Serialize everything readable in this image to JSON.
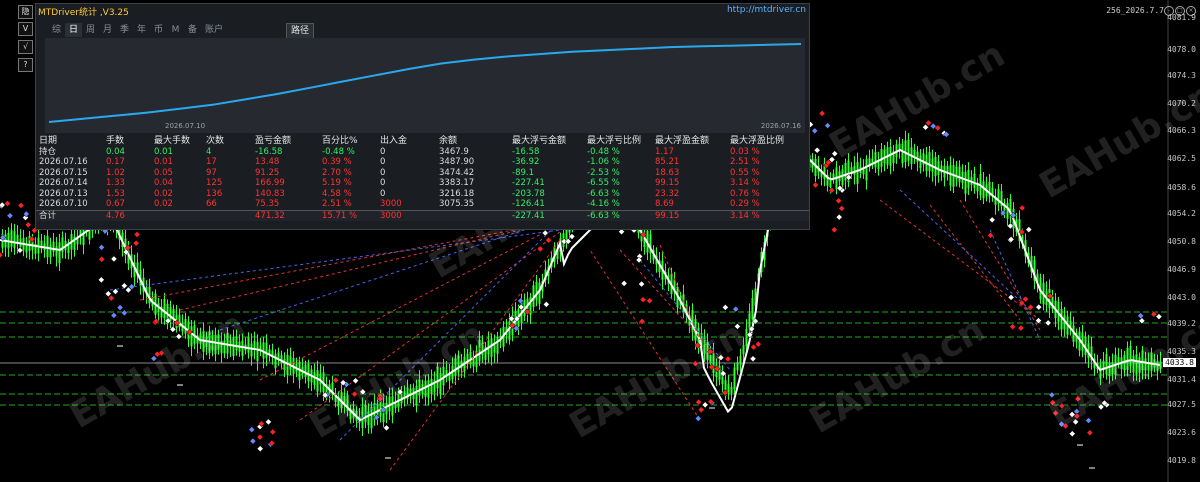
{
  "server_label": "256_2026.7.7",
  "window_controls": [
    "-",
    "□",
    "×"
  ],
  "watermark": "EAHub.cn",
  "price_axis": [
    "4081.9",
    "4078.0",
    "4074.3",
    "4070.2",
    "4066.3",
    "4062.5",
    "4058.6",
    "4054.2",
    "4050.8",
    "4046.9",
    "4043.0",
    "4039.2",
    "4035.3",
    "4033.8",
    "4031.4",
    "4027.5",
    "4023.6",
    "4019.8"
  ],
  "sidebar_buttons": [
    "隐",
    "V",
    "√",
    "?"
  ],
  "panel": {
    "title": "MTDriver统计 ,V3.25",
    "url": "http://mtdriver.cn",
    "tabs": [
      "综",
      "日",
      "周",
      "月",
      "季",
      "年",
      "币",
      "M",
      "备",
      "账户"
    ],
    "active_tab": "日",
    "path_tab": "路径",
    "chart_start_date": "2026.07.10",
    "chart_end_date": "2026.07.16",
    "columns": [
      "日期",
      "手数",
      "最大手数",
      "次数",
      "盈亏金额",
      "百分比%",
      "出入金",
      "余额",
      "最大浮亏金额",
      "最大浮亏比例",
      "最大浮盈金额",
      "最大浮盈比例"
    ],
    "rows": [
      [
        "持仓",
        "0.04",
        "0.01",
        "4",
        "-16.58",
        "-0.48 %",
        "0",
        "3467.9",
        "-16.58",
        "-0.48 %",
        "1.17",
        "0.03 %"
      ],
      [
        "2026.07.16",
        "0.17",
        "0.01",
        "17",
        "13.48",
        "0.39 %",
        "0",
        "3487.90",
        "-36.92",
        "-1.06 %",
        "85.21",
        "2.51 %"
      ],
      [
        "2026.07.15",
        "1.02",
        "0.05",
        "97",
        "91.25",
        "2.70 %",
        "0",
        "3474.42",
        "-89.1",
        "-2.53 %",
        "18.63",
        "0.55 %"
      ],
      [
        "2026.07.14",
        "1.33",
        "0.04",
        "125",
        "166.99",
        "5.19 %",
        "0",
        "3383.17",
        "-227.41",
        "-6.55 %",
        "99.15",
        "3.14 %"
      ],
      [
        "2026.07.13",
        "1.53",
        "0.02",
        "136",
        "140.83",
        "4.58 %",
        "0",
        "3216.18",
        "-203.78",
        "-6.63 %",
        "23.32",
        "0.76 %"
      ],
      [
        "2026.07.10",
        "0.67",
        "0.02",
        "66",
        "75.35",
        "2.51 %",
        "3000",
        "3075.35",
        "-126.41",
        "-4.16 %",
        "8.69",
        "0.29 %"
      ]
    ],
    "total": [
      "合计",
      "4.76",
      "",
      "",
      "471.32",
      "15.71 %",
      "3000",
      "",
      "-227.41",
      "-6.63 %",
      "99.15",
      "3.14 %"
    ],
    "equity_curve": [
      0,
      0.04,
      0.08,
      0.12,
      0.17,
      0.22,
      0.29,
      0.36,
      0.44,
      0.52,
      0.6,
      0.68,
      0.75,
      0.8,
      0.84,
      0.87,
      0.9,
      0.92,
      0.94,
      0.96,
      0.97,
      0.98,
      0.99,
      1.0
    ]
  },
  "colors": {
    "background": "#000000",
    "bull_candle": "#33ff33",
    "ma_line": "#ffffff",
    "level_line": "#22aa22",
    "equity_line": "#2aa8ee",
    "profit_text": "#ff3333",
    "loss_text": "#33ee66",
    "neutral_text": "#dddddd"
  }
}
